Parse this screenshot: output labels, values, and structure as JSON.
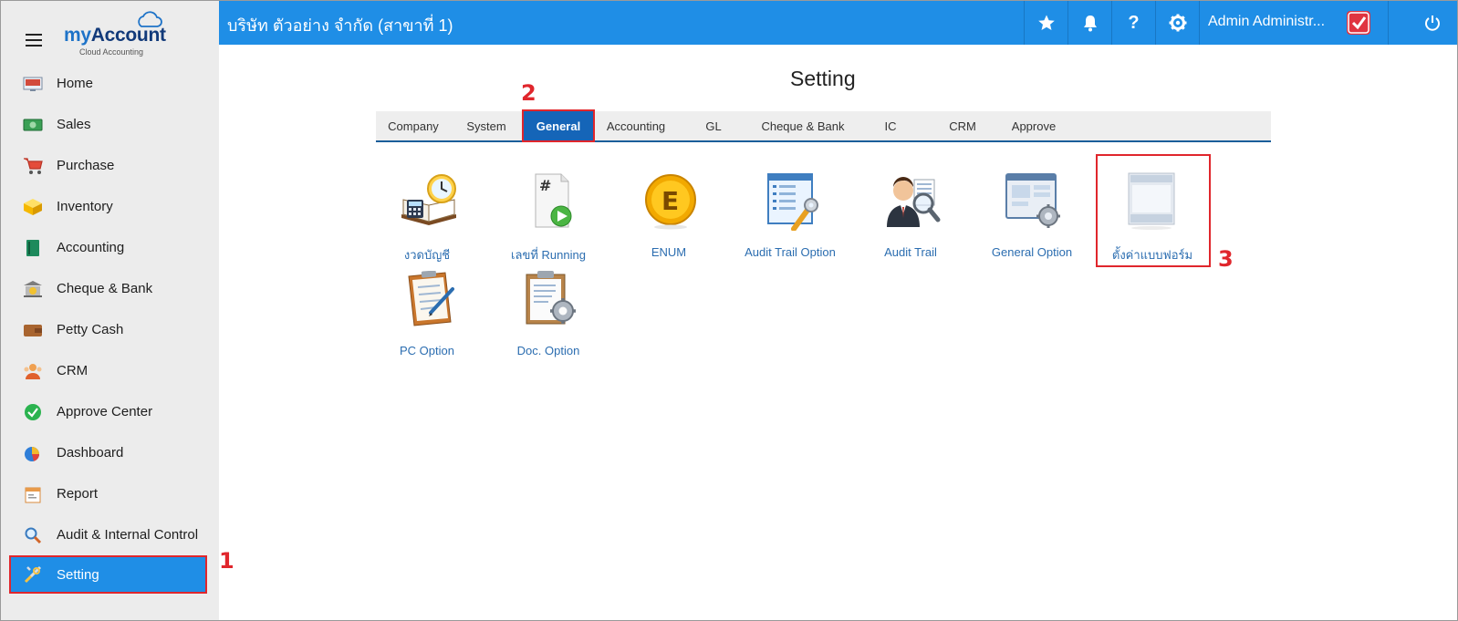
{
  "brand": {
    "logo_prefix": "my",
    "logo_name": "Account",
    "logo_sub": "Cloud Accounting"
  },
  "sidebar": {
    "items": [
      {
        "label": "Home",
        "icon": "home-icon"
      },
      {
        "label": "Sales",
        "icon": "sales-icon"
      },
      {
        "label": "Purchase",
        "icon": "cart-icon"
      },
      {
        "label": "Inventory",
        "icon": "box-icon"
      },
      {
        "label": "Accounting",
        "icon": "ledger-icon"
      },
      {
        "label": "Cheque & Bank",
        "icon": "bank-icon"
      },
      {
        "label": "Petty Cash",
        "icon": "wallet-icon"
      },
      {
        "label": "CRM",
        "icon": "people-icon"
      },
      {
        "label": "Approve Center",
        "icon": "check-circle-icon"
      },
      {
        "label": "Dashboard",
        "icon": "pie-chart-icon"
      },
      {
        "label": "Report",
        "icon": "report-icon"
      },
      {
        "label": "Audit & Internal Control",
        "icon": "magnifier-icon"
      },
      {
        "label": "Setting",
        "icon": "tools-icon",
        "active": true
      }
    ]
  },
  "topbar": {
    "company": "บริษัท ตัวอย่าง จำกัด (สาขาที่ 1)",
    "user_name": "Admin Administr...",
    "help_glyph": "?"
  },
  "main": {
    "title": "Setting",
    "tabs": [
      {
        "label": "Company"
      },
      {
        "label": "System"
      },
      {
        "label": "General",
        "active": true
      },
      {
        "label": "Accounting"
      },
      {
        "label": "GL"
      },
      {
        "label": "Cheque & Bank"
      },
      {
        "label": "IC"
      },
      {
        "label": "CRM"
      },
      {
        "label": "Approve"
      }
    ],
    "tiles": [
      {
        "label": "งวดบัญชี",
        "icon": "accounting-period-icon"
      },
      {
        "label": "เลขที่ Running",
        "icon": "running-number-icon"
      },
      {
        "label": "ENUM",
        "icon": "enum-coin-icon"
      },
      {
        "label": "Audit Trail Option",
        "icon": "audit-trail-option-icon"
      },
      {
        "label": "Audit Trail",
        "icon": "audit-trail-icon"
      },
      {
        "label": "General Option",
        "icon": "general-option-icon"
      },
      {
        "label": "ตั้งค่าแบบฟอร์ม",
        "icon": "form-setting-icon"
      },
      {
        "label": "PC Option",
        "icon": "pc-option-icon"
      },
      {
        "label": "Doc. Option",
        "icon": "doc-option-icon"
      }
    ]
  },
  "annotations": {
    "step1": "1",
    "step2": "2",
    "step3": "3"
  },
  "colors": {
    "primary": "#1f8ee6",
    "tab_active": "#1565b8",
    "highlight": "#e0262c",
    "link": "#2b6db0",
    "sidebar_bg": "#ececec"
  }
}
